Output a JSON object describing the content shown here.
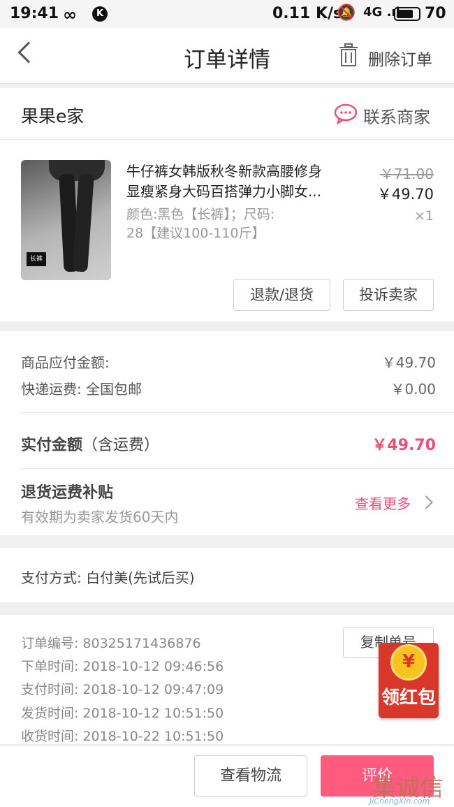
{
  "status_bar": {
    "time": "19:41",
    "infinity_icon": "∞",
    "k_badge": "K",
    "speed": "0.11 K/s",
    "signal": "4G .ıl",
    "battery_pct": "70"
  },
  "header": {
    "title": "订单详情",
    "delete_label": "删除订单"
  },
  "shop": {
    "name": "果果e家",
    "contact_label": "联系商家"
  },
  "product": {
    "name_line1": "牛仔裤女韩版秋冬新款高腰修身",
    "name_line2": "显瘦紧身大码百搭弹力小脚女...",
    "spec_line1": "颜色:黑色【长裤】；尺码:",
    "spec_line2": "28【建议100-110斤】",
    "original_price": "￥71.00",
    "price": "￥49.70",
    "quantity": "×1",
    "thumb_tag": "长裤",
    "refund_button": "退款/退货",
    "complain_button": "投诉卖家"
  },
  "amounts": {
    "goods_label": "商品应付金额:",
    "goods_value": "￥49.70",
    "shipping_label": "快递运费:  全国包邮",
    "shipping_value": "￥0.00",
    "paid_label_bold": "实付金额",
    "paid_label_suffix": "（含运费）",
    "paid_value": "￥49.70",
    "return_subsidy_title": "退货运费补贴",
    "return_subsidy_desc": "有效期为卖家发货60天内",
    "see_more": "查看更多"
  },
  "payment": {
    "method": "支付方式:  白付美(先试后买)"
  },
  "order_info": {
    "order_no_label": "订单编号:",
    "order_no": "80325171436876",
    "order_time_label": "下单时间:",
    "order_time": "2018-10-12  09:46:56",
    "pay_time_label": "支付时间:",
    "pay_time": "2018-10-12  09:47:09",
    "ship_time_label": "发货时间:",
    "ship_time": "2018-10-12  10:51:50",
    "receive_time_label": "收货时间:",
    "receive_time": "2018-10-22  10:51:50",
    "copy_button": "复制单号"
  },
  "red_packet": {
    "coin": "¥",
    "label": "领红包"
  },
  "bottom_bar": {
    "logistics_button": "查看物流",
    "review_button": "评价"
  },
  "watermark": {
    "text_big": "集诚信",
    "text_small": "JiChengXin.com"
  },
  "colors": {
    "accent_pink": "#e8507a",
    "review_button_bg": "#ff5b7f",
    "red_packet_bg": "#d9372a"
  }
}
